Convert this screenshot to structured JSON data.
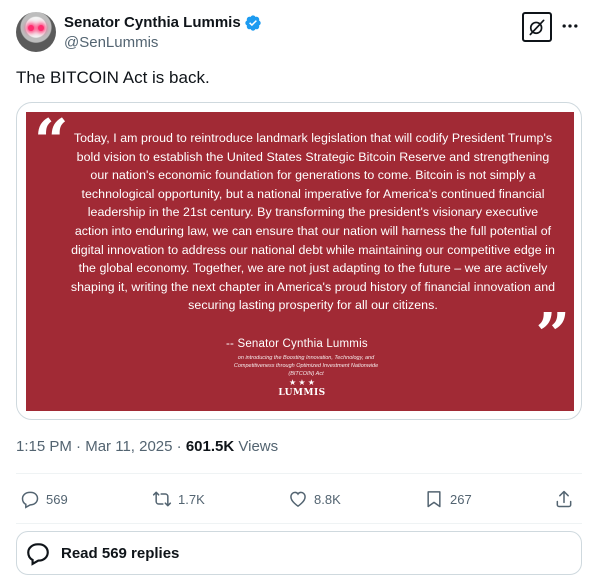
{
  "author": {
    "display_name": "Senator Cynthia Lummis",
    "handle": "@SenLummis"
  },
  "tweet": {
    "text": "The BITCOIN Act is back."
  },
  "quote_image": {
    "body": "Today, I am proud to reintroduce landmark legislation that will codify President Trump's bold vision to establish the United States Strategic Bitcoin Reserve and strengthening our nation's economic foundation for generations to come. Bitcoin is not simply a technological opportunity, but a national imperative for America's continued financial leadership in the 21st century. By transforming the president's visionary executive action into enduring law, we can ensure that our nation will harness the full potential of digital innovation to address our national debt while maintaining our competitive edge in the global economy. Together, we are not just adapting to the future – we are actively shaping it, writing the next chapter in America's proud history of financial innovation and securing lasting prosperity for all our citizens.",
    "attribution": "-- Senator Cynthia Lummis",
    "context": "on introducing the Boosting Innovation, Technology, and Competitiveness through Optimized Investment Nationwide (BITCOIN) Act",
    "logo_text": "LUMMIS",
    "background_color": "#a12a35"
  },
  "meta": {
    "time": "1:15 PM",
    "separator": "·",
    "date": "Mar 11, 2025",
    "views_count": "601.5K",
    "views_label": "Views"
  },
  "actions": {
    "replies": "569",
    "reposts": "1.7K",
    "likes": "8.8K",
    "bookmarks": "267"
  },
  "read_replies_label": "Read 569 replies",
  "colors": {
    "verified_blue": "#1d9bf0",
    "text_primary": "#0f1419",
    "text_secondary": "#536471",
    "border": "#cfd9de"
  }
}
